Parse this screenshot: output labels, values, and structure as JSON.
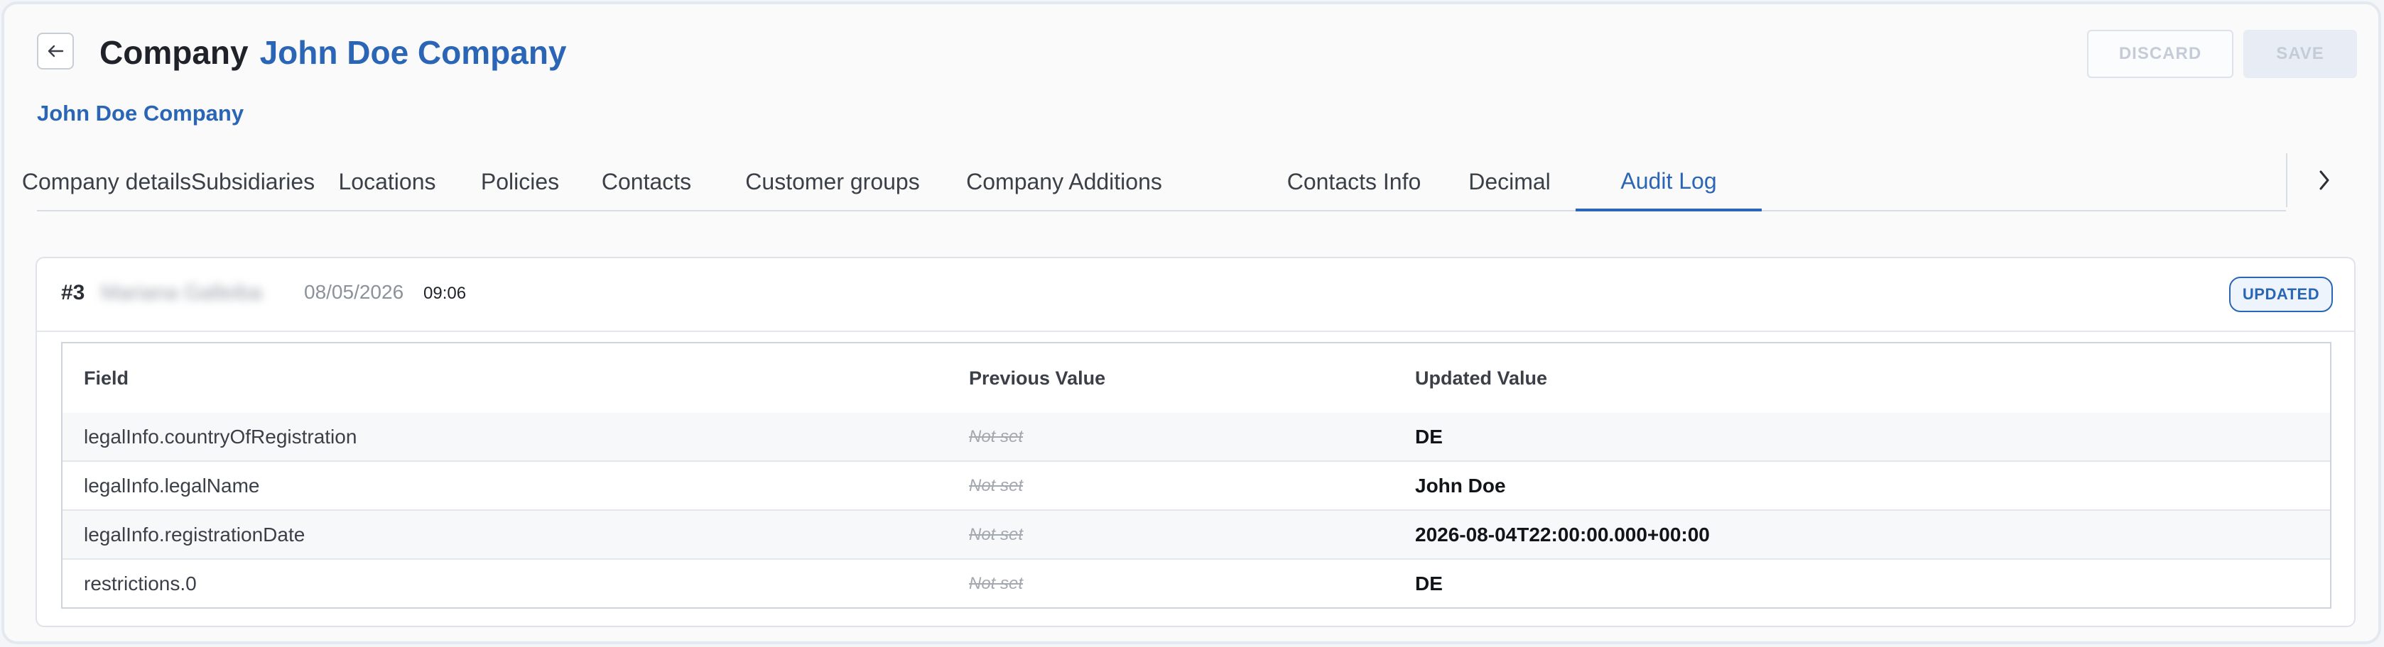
{
  "header": {
    "entity_type": "Company",
    "entity_name": "John Doe Company",
    "discard_label": "DISCARD",
    "save_label": "SAVE"
  },
  "breadcrumb": "John Doe Company",
  "tabs": [
    {
      "label": "Company details",
      "active": false
    },
    {
      "label": "Subsidiaries",
      "active": false
    },
    {
      "label": "Locations",
      "active": false
    },
    {
      "label": "Policies",
      "active": false
    },
    {
      "label": "Contacts",
      "active": false
    },
    {
      "label": "Customer groups",
      "active": false
    },
    {
      "label": "Company Additions",
      "active": false
    },
    {
      "label": "Contacts Info",
      "active": false
    },
    {
      "label": "Decimal",
      "active": false
    },
    {
      "label": "Audit Log",
      "active": true
    }
  ],
  "audit_entry": {
    "number": "#3",
    "user": "Mariana Galleiba",
    "date": "08/05/2026",
    "time": "09:06",
    "status": "UPDATED",
    "columns": [
      "Field",
      "Previous Value",
      "Updated Value"
    ],
    "rows": [
      {
        "field": "legalInfo.countryOfRegistration",
        "previous": "Not set",
        "updated": "DE"
      },
      {
        "field": "legalInfo.legalName",
        "previous": "Not set",
        "updated": "John Doe"
      },
      {
        "field": "legalInfo.registrationDate",
        "previous": "Not set",
        "updated": "2026-08-04T22:00:00.000+00:00"
      },
      {
        "field": "restrictions.0",
        "previous": "Not set",
        "updated": "DE"
      }
    ]
  },
  "icons": {
    "back": "arrow-left-icon",
    "tabs_next": "chevron-right-icon"
  },
  "colors": {
    "accent": "#2a66b5",
    "text": "#1f2329",
    "muted": "#a4a9b0",
    "border": "#dfe3e9"
  }
}
